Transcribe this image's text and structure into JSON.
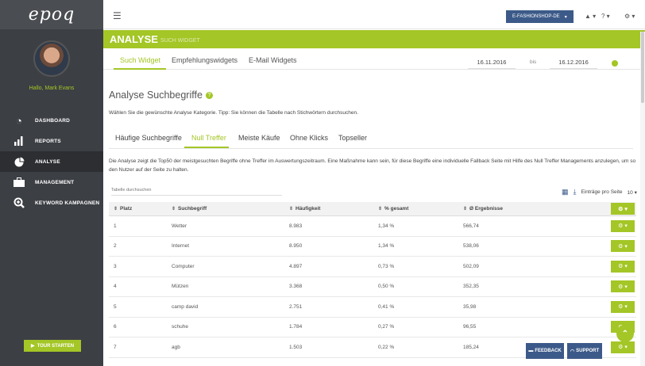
{
  "sidebar": {
    "logo": "epoq",
    "greeting": "Hallo, Mark Evans",
    "items": [
      {
        "label": "DASHBOARD",
        "icon": "gauge-icon"
      },
      {
        "label": "REPORTS",
        "icon": "bar-chart-icon"
      },
      {
        "label": "ANALYSE",
        "icon": "pie-chart-icon"
      },
      {
        "label": "MANAGEMENT",
        "icon": "briefcase-icon"
      },
      {
        "label": "KEYWORD KAMPAGNEN",
        "icon": "search-plus-icon"
      }
    ],
    "active_index": 2,
    "tour_button": "TOUR STARTEN"
  },
  "topbar": {
    "shop": "E-FASHIONSHOP-DE",
    "bell": "▲",
    "help": "?",
    "settings": "⚙"
  },
  "header": {
    "title": "ANALYSE",
    "subtitle": "SUCH WIDGET"
  },
  "subtabs": [
    {
      "label": "Such Widget"
    },
    {
      "label": "Empfehlungswidgets"
    },
    {
      "label": "E-Mail Widgets"
    }
  ],
  "date_range": {
    "from": "16.11.2016",
    "to_label": "bis",
    "to": "16.12.2016"
  },
  "section": {
    "title": "Analyse Suchbegriffe",
    "hint": "Wählen Sie die gewünschte Analyse Kategorie. Tipp: Sie können die Tabelle nach Stichwörtern durchsuchen.",
    "tabs": [
      {
        "label": "Häufige Suchbegriffe"
      },
      {
        "label": "Null Treffer"
      },
      {
        "label": "Meiste Käufe"
      },
      {
        "label": "Ohne Klicks"
      },
      {
        "label": "Topseller"
      }
    ],
    "active_tab": 1,
    "description": "Die Analyse zeigt die Top50 der meistgesuchten Begriffe ohne Treffer im Auswertungszeitraum. Eine Maßnahme kann sein, für diese Begriffe eine individuelle Fallback Seite mit Hilfe des Null Treffer Managements anzulegen, um so den Nutzer auf der Seite zu halten."
  },
  "table_tools": {
    "search_placeholder": "Tabelle durchsuchen",
    "per_page_label": "Einträge pro Seite",
    "per_page_value": "10"
  },
  "table": {
    "columns": [
      "Platz",
      "Suchbegriff",
      "Häufigkeit",
      "% gesamt",
      "Ø Ergebnisse"
    ],
    "rows": [
      [
        "1",
        "Wetter",
        "8.983",
        "1,34 %",
        "566,74"
      ],
      [
        "2",
        "Internet",
        "8.950",
        "1,34 %",
        "538,06"
      ],
      [
        "3",
        "Computer",
        "4.897",
        "0,73 %",
        "502,09"
      ],
      [
        "4",
        "Mützen",
        "3.368",
        "0,50 %",
        "352,35"
      ],
      [
        "5",
        "camp david",
        "2.751",
        "0,41 %",
        "35,98"
      ],
      [
        "6",
        "schuhe",
        "1.784",
        "0,27 %",
        "96,55"
      ],
      [
        "7",
        "agb",
        "1.503",
        "0,22 %",
        "185,24"
      ]
    ]
  },
  "footer_buttons": {
    "feedback": "FEEDBACK",
    "support": "SUPPORT"
  },
  "colors": {
    "accent": "#a4c626",
    "sidebar": "#3c3f44",
    "navy": "#3c5a89"
  }
}
